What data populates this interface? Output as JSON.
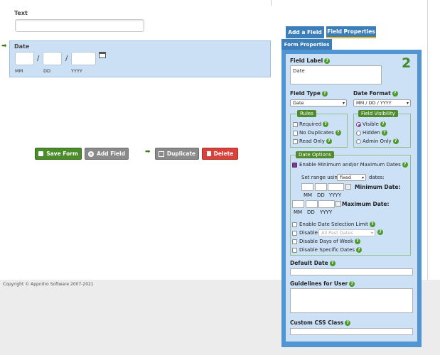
{
  "form": {
    "text_label": "Text",
    "date_label": "Date",
    "date_sub_mm": "MM",
    "date_sub_dd": "DD",
    "date_sub_yyyy": "YYYY",
    "slash": "/"
  },
  "buttons": {
    "save": "Save Form",
    "add_field": "Add Field",
    "duplicate": "Duplicate",
    "delete": "Delete"
  },
  "footer": {
    "copyright": "Copyright © Appnitro Software 2007-2021"
  },
  "tabs": {
    "add_field": "Add a Field",
    "field_properties": "Field Properties"
  },
  "panel": {
    "tab_label": "Form Properties",
    "step_number": "2",
    "field_label_title": "Field Label",
    "field_label_value": "Date",
    "field_type_title": "Field Type",
    "field_type_value": "Date",
    "date_format_title": "Date Format",
    "date_format_value": "MM / DD / YYYY",
    "rules": {
      "legend": "Rules",
      "items": [
        {
          "label": "Required",
          "checked": false
        },
        {
          "label": "No Duplicates",
          "checked": false
        },
        {
          "label": "Read Only",
          "checked": false
        }
      ]
    },
    "visibility": {
      "legend": "Field Visibility",
      "items": [
        {
          "label": "Visible",
          "checked": true
        },
        {
          "label": "Hidden",
          "checked": false
        },
        {
          "label": "Admin Only",
          "checked": false
        }
      ]
    },
    "date_options": {
      "legend": "Date Options",
      "enable_minmax": "Enable Minimum and/or Maximum Dates",
      "range_prefix": "Set range using",
      "range_value": "fixed",
      "range_suffix": "dates:",
      "min_label": "Minimum Date:",
      "max_label": "Maximum Date:",
      "mm": "MM",
      "dd": "DD",
      "yyyy": "YYYY",
      "enable_limit": "Enable Date Selection Limit",
      "disable": "Disable",
      "disable_select": "All Past Dates",
      "disable_days": "Disable Days of Week",
      "disable_specific": "Disable Specific Dates"
    },
    "default_date": "Default Date",
    "guidelines": "Guidelines for User",
    "css_class": "Custom CSS Class"
  },
  "colors": {
    "accent_blue": "#3c7eb9",
    "panel_blue": "#5196d2",
    "save_green": "#4a8c2a",
    "delete_red": "#d9413a",
    "help_green": "#4f9a2c"
  }
}
